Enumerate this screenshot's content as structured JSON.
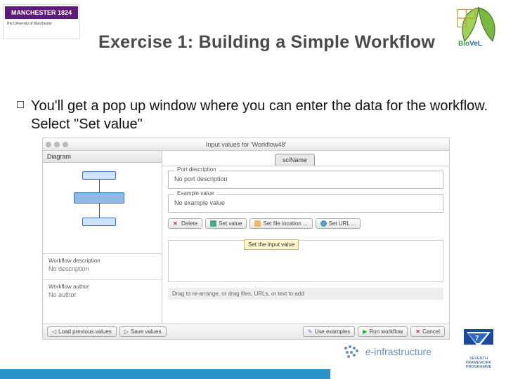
{
  "title": "Exercise 1: Building a Simple Workflow",
  "bullet": "You'll get a pop up window where you can enter the data for the workflow. Select \"Set value\"",
  "manchester": {
    "badge": "MANCHESTER 1824",
    "sub": "The University of Manchester"
  },
  "biovel": {
    "bio": "Bio",
    "vel": "VeL"
  },
  "shot": {
    "window_title": "Input values for 'Workflow48'",
    "left": {
      "diagram_header": "Diagram",
      "desc_label": "Workflow description",
      "desc_value": "No description",
      "author_label": "Workflow author",
      "author_value": "No author"
    },
    "tab_label": "sciName",
    "port_desc_label": "Port description",
    "port_desc_value": "No port description",
    "example_label": "Example value",
    "example_value": "No example value",
    "toolbar": {
      "delete": "Delete",
      "set_value": "Set value",
      "set_file": "Set file location ...",
      "set_url": "Set URL ..."
    },
    "tooltip": "Set the input value",
    "drag_hint": "Drag to re-arrange, or drag files, URLs, or text to add",
    "footer": {
      "load_prev": "Load previous values",
      "save_vals": "Save values",
      "use_examples": "Use examples",
      "run": "Run workflow",
      "cancel": "Cancel"
    }
  },
  "einfra": "-infrastructure",
  "fp7": {
    "line1": "SEVENTH FRAMEWORK",
    "line2": "PROGRAMME"
  }
}
